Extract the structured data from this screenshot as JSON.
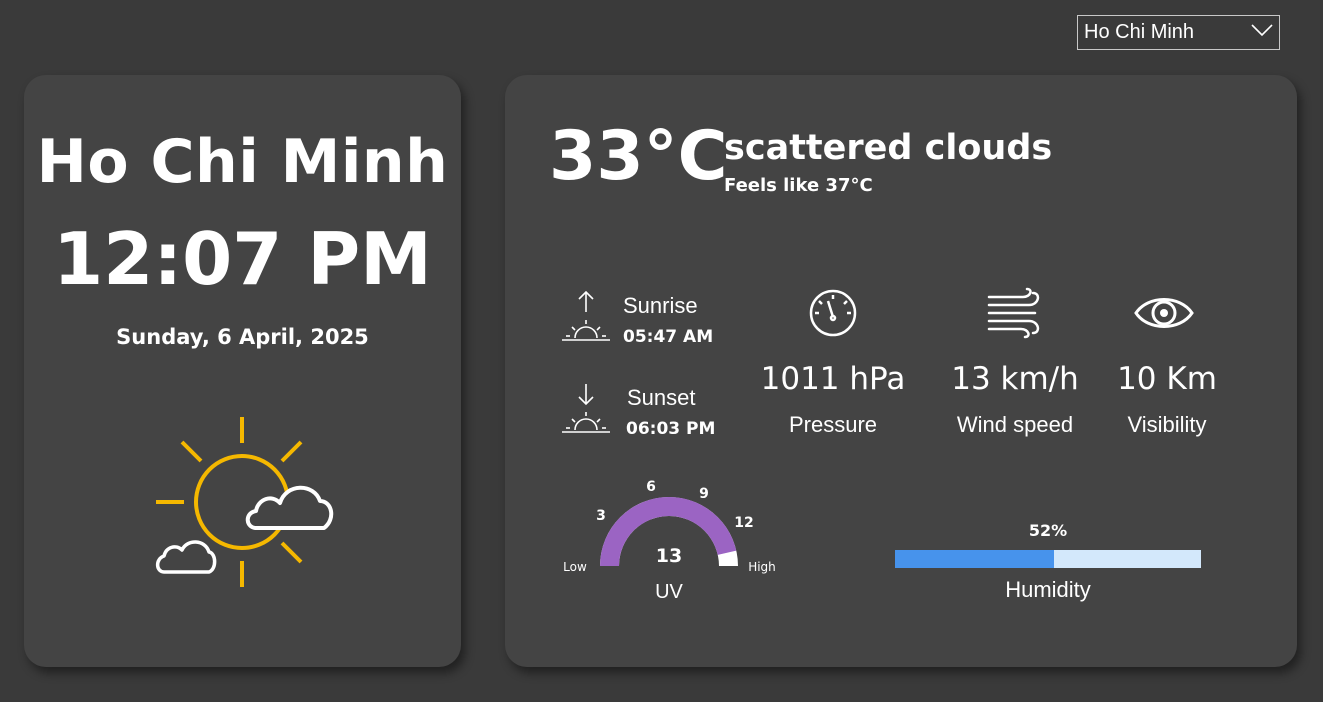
{
  "city_selector": {
    "value": "Ho Chi Minh",
    "icon": "chevron-down-icon"
  },
  "left_card": {
    "city": "Ho Chi Minh",
    "time": "12:07 PM",
    "date": "Sunday, 6 April, 2025",
    "icon": "partly-sunny-weather-icon"
  },
  "current": {
    "temperature": "33°C",
    "description": "scattered clouds",
    "feels_like": "Feels like 37°C"
  },
  "sun": {
    "sunrise_label": "Sunrise",
    "sunrise_time": "05:47 AM",
    "sunset_label": "Sunset",
    "sunset_time": "06:03 PM",
    "sunrise_icon": "sunrise-icon",
    "sunset_icon": "sunset-icon"
  },
  "metrics": {
    "pressure": {
      "value": "1011 hPa",
      "label": "Pressure",
      "icon": "gauge-icon"
    },
    "wind": {
      "value": "13 km/h",
      "label": "Wind speed",
      "icon": "wind-icon"
    },
    "visibility": {
      "value": "10 Km",
      "label": "Visibility",
      "icon": "eye-icon"
    }
  },
  "uv": {
    "value": 13,
    "value_text": "13",
    "label": "UV",
    "min_label": "Low",
    "max_label": "High",
    "ticks": [
      "3",
      "6",
      "9",
      "12"
    ],
    "scale_max": 14,
    "color": "#9b64c3",
    "track_color": "#ffffff"
  },
  "humidity": {
    "value": 0.52,
    "display": "52%",
    "label": "Humidity",
    "fill_color": "#4793ec",
    "track_color": "#d3e8fb"
  },
  "colors": {
    "background": "#3a3a3a",
    "card": "#444444",
    "sun_icon": "#f5b800"
  }
}
